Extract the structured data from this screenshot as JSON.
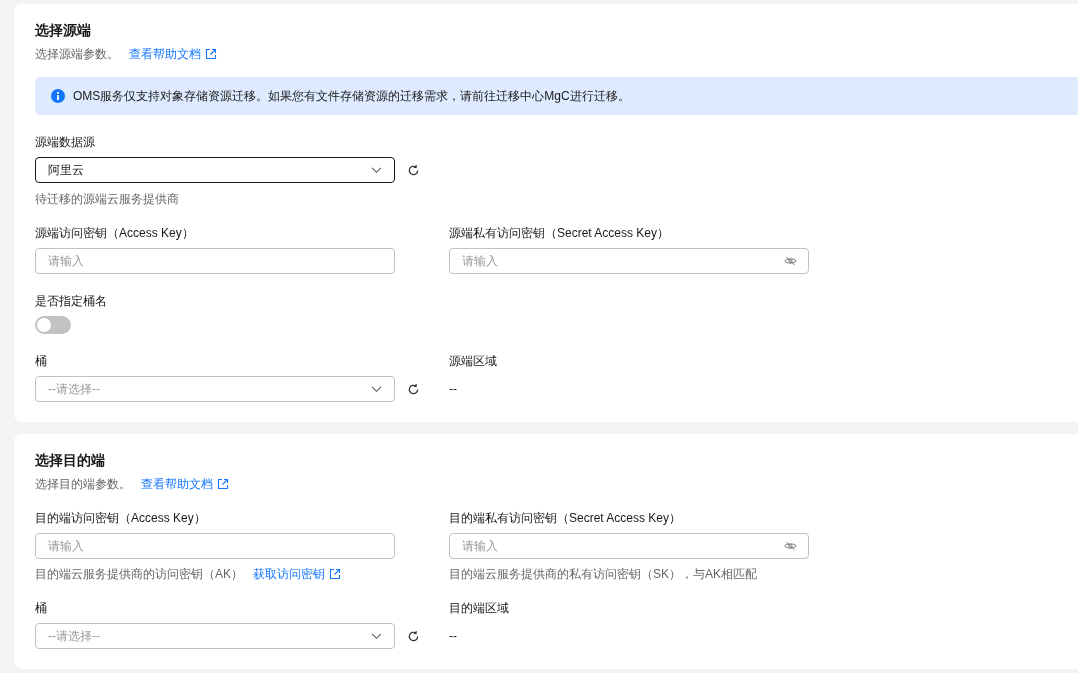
{
  "sections": [
    {
      "title": "选择源端",
      "description": "选择源端参数。",
      "help_link": "查看帮助文档",
      "notice": "OMS服务仅支持对象存储资源迁移。如果您有文件存储资源的迁移需求，请前往迁移中心MgC进行迁移。",
      "provider": {
        "label": "源端数据源",
        "value": "阿里云",
        "hint": "待迁移的源端云服务提供商"
      },
      "access_key": {
        "label": "源端访问密钥（Access Key）",
        "placeholder": "请输入"
      },
      "secret_key": {
        "label": "源端私有访问密钥（Secret Access Key）",
        "placeholder": "请输入"
      },
      "specify_bucket": {
        "label": "是否指定桶名",
        "on": false
      },
      "bucket": {
        "label": "桶",
        "placeholder": "--请选择--"
      },
      "region": {
        "label": "源端区域",
        "value": "--"
      }
    },
    {
      "title": "选择目的端",
      "description": "选择目的端参数。",
      "help_link": "查看帮助文档",
      "access_key": {
        "label": "目的端访问密钥（Access Key）",
        "placeholder": "请输入",
        "hint": "目的端云服务提供商的访问密钥（AK）",
        "hint_link": "获取访问密钥"
      },
      "secret_key": {
        "label": "目的端私有访问密钥（Secret Access Key）",
        "placeholder": "请输入",
        "hint": "目的端云服务提供商的私有访问密钥（SK），与AK相匹配"
      },
      "bucket": {
        "label": "桶",
        "placeholder": "--请选择--"
      },
      "region": {
        "label": "目的端区域",
        "value": "--"
      }
    }
  ]
}
